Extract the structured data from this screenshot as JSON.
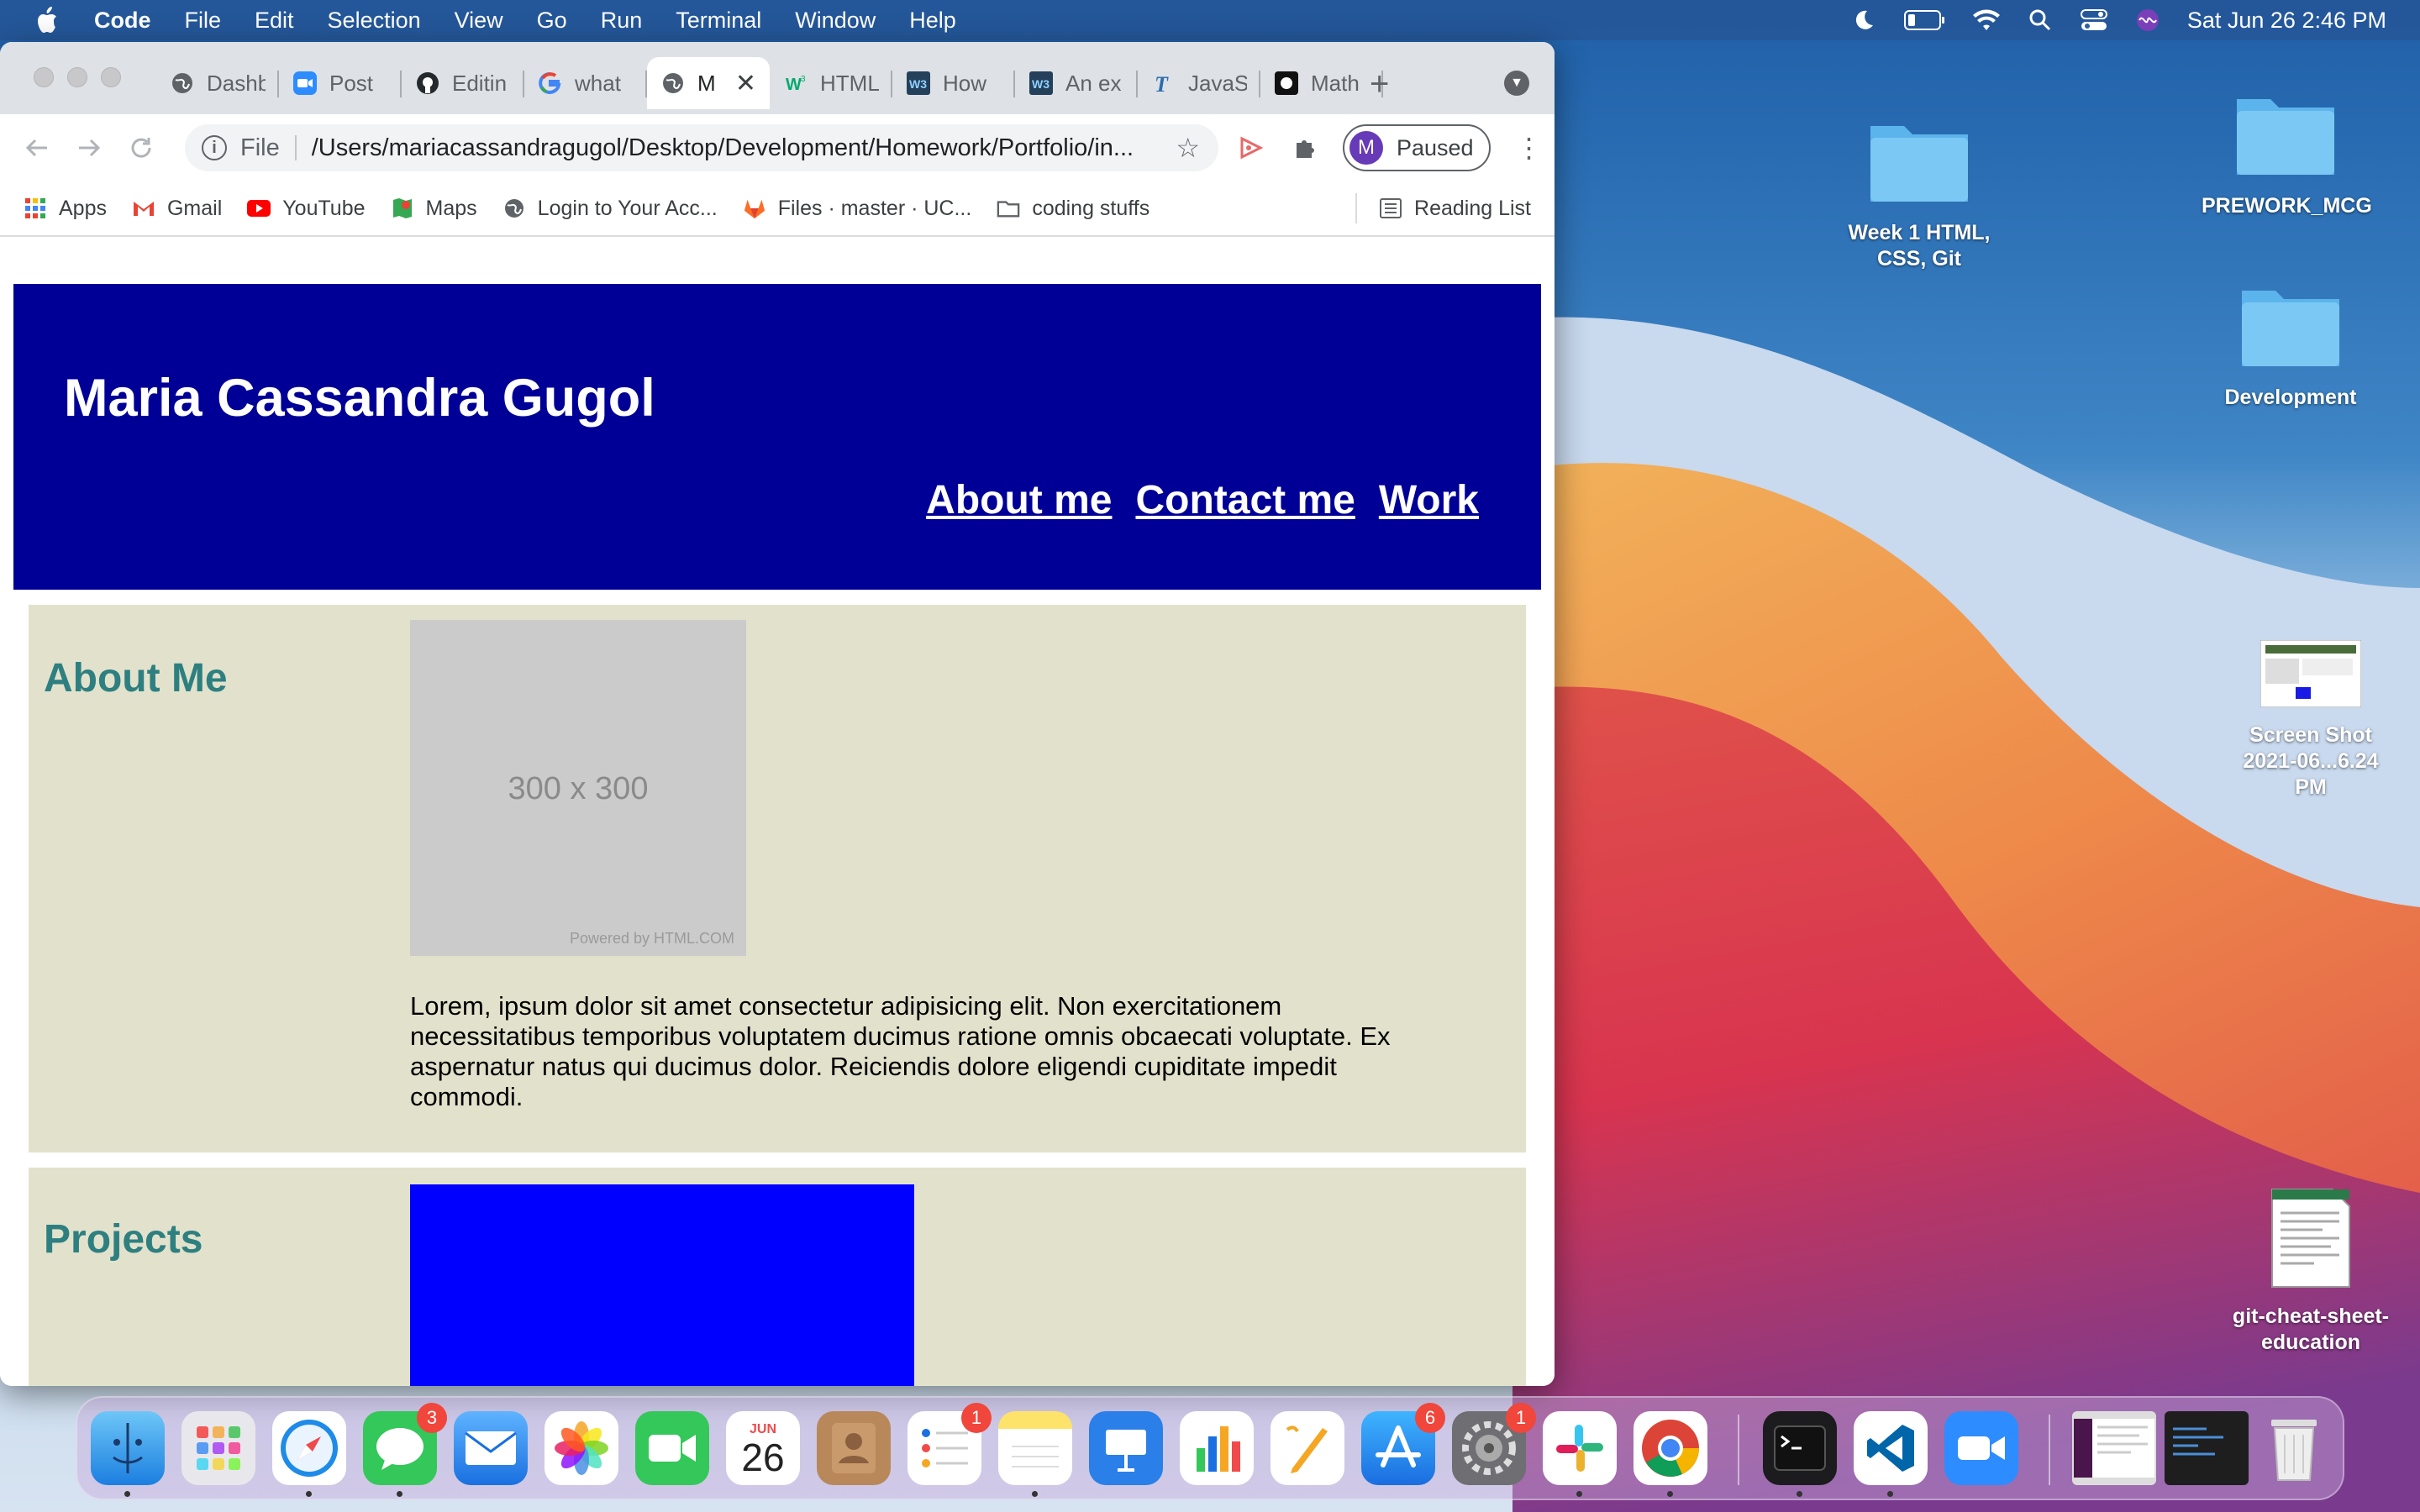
{
  "menubar": {
    "app_name": "Code",
    "items": [
      "File",
      "Edit",
      "Selection",
      "View",
      "Go",
      "Run",
      "Terminal",
      "Window",
      "Help"
    ],
    "clock": "Sat Jun 26  2:46 PM"
  },
  "browser": {
    "tabs": [
      {
        "label": "Dashb",
        "icon": "globe-icon"
      },
      {
        "label": "Post",
        "icon": "zoom-icon"
      },
      {
        "label": "Editin",
        "icon": "github-icon"
      },
      {
        "label": "what",
        "icon": "google-icon"
      },
      {
        "label": "M",
        "icon": "globe-icon",
        "active": true
      },
      {
        "label": "HTML",
        "icon": "w3schools-icon"
      },
      {
        "label": "How",
        "icon": "w3-icon"
      },
      {
        "label": "An ex",
        "icon": "w3-icon"
      },
      {
        "label": "JavaS",
        "icon": "t-icon"
      },
      {
        "label": "Math",
        "icon": "khan-icon"
      }
    ],
    "omnibox": {
      "scheme": "File",
      "url": "/Users/mariacassandragugol/Desktop/Development/Homework/Portfolio/in..."
    },
    "profile": {
      "initial": "M",
      "status": "Paused"
    },
    "bookmarks": [
      {
        "label": "Apps",
        "icon": "apps-grid-icon"
      },
      {
        "label": "Gmail",
        "icon": "gmail-icon"
      },
      {
        "label": "YouTube",
        "icon": "youtube-icon"
      },
      {
        "label": "Maps",
        "icon": "maps-icon"
      },
      {
        "label": "Login to Your Acc...",
        "icon": "globe-icon"
      },
      {
        "label": "Files · master · UC...",
        "icon": "gitlab-icon"
      },
      {
        "label": "coding stuffs",
        "icon": "folder-icon"
      }
    ],
    "reading_list": "Reading List"
  },
  "page": {
    "header": {
      "title": "Maria Cassandra Gugol",
      "nav": [
        "About me",
        "Contact me",
        "Work"
      ]
    },
    "about": {
      "heading": "About Me",
      "image_label": "300 x 300",
      "image_credit": "Powered by HTML.COM",
      "text": "Lorem, ipsum dolor sit amet consectetur adipisicing elit. Non exercitationem necessitatibus temporibus voluptatem ducimus ratione omnis obcaecati voluptate. Ex aspernatur natus qui ducimus dolor. Reiciendis dolore eligendi cupiditate impedit commodi."
    },
    "projects": {
      "heading": "Projects"
    }
  },
  "desktop": {
    "icons": [
      {
        "label": "Week 1 HTML, CSS, Git",
        "type": "folder-icon"
      },
      {
        "label": "PREWORK_MCG",
        "type": "folder-icon"
      },
      {
        "label": "Development",
        "type": "folder-icon"
      },
      {
        "label": "Screen Shot 2021-06...6.24 PM",
        "type": "screenshot-icon"
      },
      {
        "label": "git-cheat-sheet-education",
        "type": "document-icon"
      }
    ]
  },
  "dock": {
    "badges": {
      "messages": "3",
      "reminders": "1",
      "app_store": "6",
      "system_prefs": "1"
    },
    "calendar": {
      "month": "JUN",
      "day": "26"
    }
  },
  "colors": {
    "site_header": "#000096",
    "section_bg": "#e2e2cc",
    "heading": "#2e7f80",
    "project_block": "#0000ff"
  }
}
